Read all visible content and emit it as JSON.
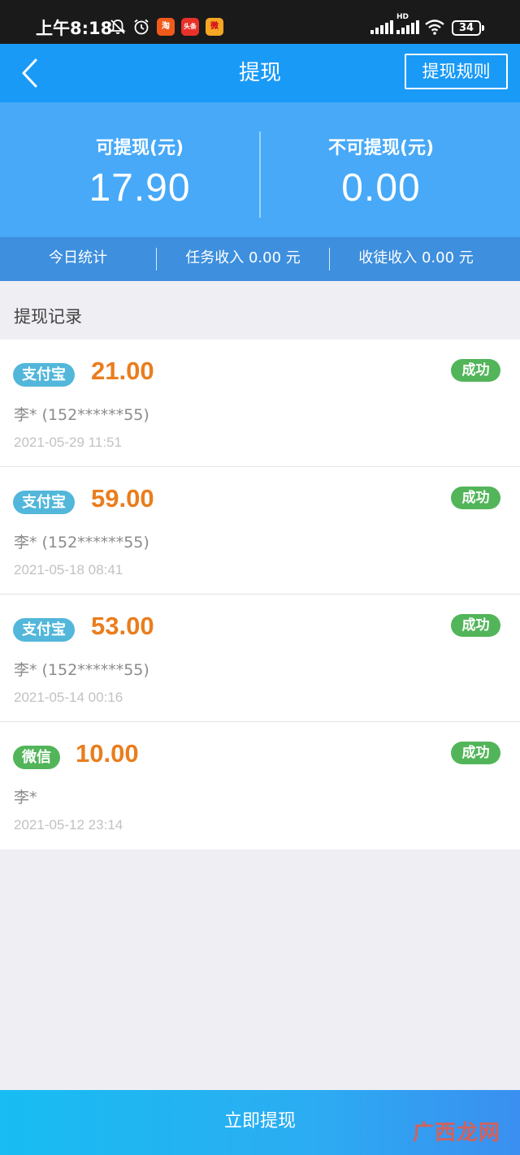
{
  "status_bar": {
    "time": "上午8:18",
    "icons": [
      "bell-mute-icon",
      "alarm-icon",
      "taobao-app-icon",
      "toutiao-app-icon",
      "weibo-app-icon",
      "signal-icon",
      "hd-signal-icon",
      "wifi-icon"
    ],
    "app_icon_labels": {
      "taobao": "淘",
      "toutiao": "头条",
      "weibo": "微"
    },
    "hd_label": "HD",
    "battery": "34"
  },
  "nav": {
    "title": "提现",
    "rules_button": "提现规则",
    "back_icon": "chevron-left-icon"
  },
  "balance": {
    "withdrawable_label": "可提现(元)",
    "withdrawable_value": "17.90",
    "non_withdrawable_label": "不可提现(元)",
    "non_withdrawable_value": "0.00"
  },
  "stats": {
    "today_label": "今日统计",
    "task_income": "任务收入 0.00 元",
    "disciple_income": "收徒收入 0.00 元"
  },
  "records_title": "提现记录",
  "records": [
    {
      "method": "支付宝",
      "amount": "21.00",
      "status": "成功",
      "payee": "李* (152******55)",
      "time": "2021-05-29 11:51"
    },
    {
      "method": "支付宝",
      "amount": "59.00",
      "status": "成功",
      "payee": "李* (152******55)",
      "time": "2021-05-18 08:41"
    },
    {
      "method": "支付宝",
      "amount": "53.00",
      "status": "成功",
      "payee": "李* (152******55)",
      "time": "2021-05-14 00:16"
    },
    {
      "method": "微信",
      "amount": "10.00",
      "status": "成功",
      "payee": "李*",
      "time": "2021-05-12 23:14"
    }
  ],
  "colors": {
    "nav_blue": "#1a9af7",
    "alipay_badge": "#52b7da",
    "wechat_badge": "#53b55a",
    "success_badge": "#53b55a",
    "amount_orange": "#ea7d1d"
  },
  "withdraw_button": "立即提现",
  "watermark": "广西龙网"
}
